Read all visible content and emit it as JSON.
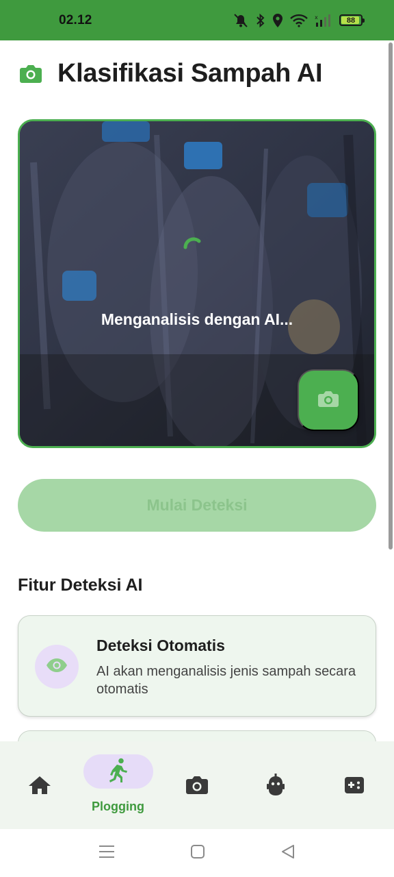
{
  "status_bar": {
    "time": "02.12",
    "battery": "88",
    "battery_level": 0.88,
    "icons": [
      "mute-icon",
      "bluetooth-icon",
      "location-icon",
      "wifi-icon",
      "signal-icon",
      "battery-icon"
    ]
  },
  "header": {
    "icon": "camera-icon",
    "title": "Klasifikasi Sampah AI"
  },
  "preview": {
    "status_text": "Menganalisis dengan AI...",
    "capture_icon": "camera-icon"
  },
  "start_button": {
    "label": "Mulai Deteksi"
  },
  "features": {
    "section_title": "Fitur Deteksi AI",
    "items": [
      {
        "icon": "eye-icon",
        "title": "Deteksi Otomatis",
        "description": "AI akan menganalisis jenis sampah secara otomatis"
      }
    ]
  },
  "bottom_nav": {
    "items": [
      {
        "icon": "home-icon",
        "label": ""
      },
      {
        "icon": "running-icon",
        "label": "Plogging",
        "active": true
      },
      {
        "icon": "camera-icon",
        "label": ""
      },
      {
        "icon": "robot-icon",
        "label": ""
      },
      {
        "icon": "gamepad-icon",
        "label": ""
      }
    ]
  },
  "colors": {
    "primary": "#4caf50",
    "status_bar": "#3f9a3e",
    "active_pill": "#e6dcf8",
    "nav_background": "#f0f5ef"
  }
}
